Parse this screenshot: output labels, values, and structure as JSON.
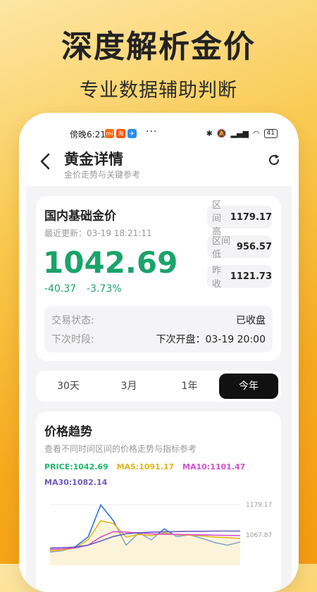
{
  "promo": {
    "headline": "深度解析金价",
    "subhead": "专业数据辅助判断"
  },
  "status_bar": {
    "time": "傍晚6:21",
    "app_icons": [
      "mi-app-icon",
      "taobao-icon",
      "plane-icon"
    ],
    "more": "···",
    "battery": "41"
  },
  "header": {
    "title": "黄金详情",
    "subtitle": "金价走势与关键参考"
  },
  "quote": {
    "title": "国内基础金价",
    "updated_label": "最近更新：",
    "updated_value": "03-19 18:21:11",
    "price": "1042.69",
    "change": "-40.37",
    "change_pct": "-3.73%",
    "stats": [
      {
        "label": "区间高",
        "value": "1179.17"
      },
      {
        "label": "区间低",
        "value": "956.57"
      },
      {
        "label": "昨收",
        "value": "1121.73"
      }
    ],
    "trade_status_label": "交易状态:",
    "trade_status_value": "已收盘",
    "next_session_label": "下次时段:",
    "next_session_value": "下次开盘：03-19 20:00"
  },
  "range_tabs": {
    "items": [
      "30天",
      "3月",
      "1年",
      "今年"
    ],
    "active": 3
  },
  "trend": {
    "title": "价格趋势",
    "subtitle": "查看不同时间区间的价格走势与指标参考",
    "legend": [
      {
        "text": "PRICE:1042.69",
        "color": "#1fb86e"
      },
      {
        "text": "MA5:1091.17",
        "color": "#e2b617"
      },
      {
        "text": "MA10:1101.47",
        "color": "#d64fd0"
      },
      {
        "text": "MA30:1082.14",
        "color": "#6a5bbf"
      }
    ]
  },
  "chart_data": {
    "type": "line",
    "y_tick_labels": [
      "1179.17",
      "1067.87"
    ],
    "ylim": [
      956.57,
      1179.17
    ],
    "series": [
      {
        "color": "#2f6fe0",
        "values": [
          1005,
          1010,
          1025,
          1060,
          1178,
          1120,
          1030,
          1075,
          1050,
          1090,
          1062,
          1068,
          1055,
          1040,
          1030,
          1042
        ]
      },
      {
        "color": "#e2b617",
        "values": [
          1010,
          1012,
          1020,
          1050,
          1120,
          1110,
          1060,
          1070,
          1065,
          1075,
          1068,
          1067,
          1064,
          1060,
          1058,
          1055
        ]
      },
      {
        "color": "#d64fd0",
        "values": [
          1015,
          1016,
          1020,
          1030,
          1060,
          1080,
          1078,
          1075,
          1072,
          1070,
          1070,
          1069,
          1068,
          1067,
          1066,
          1065
        ]
      },
      {
        "color": "#6a5bbf",
        "values": [
          1020,
          1021,
          1023,
          1030,
          1045,
          1062,
          1072,
          1076,
          1078,
          1079,
          1080,
          1081,
          1081,
          1082,
          1082,
          1082
        ]
      }
    ]
  }
}
